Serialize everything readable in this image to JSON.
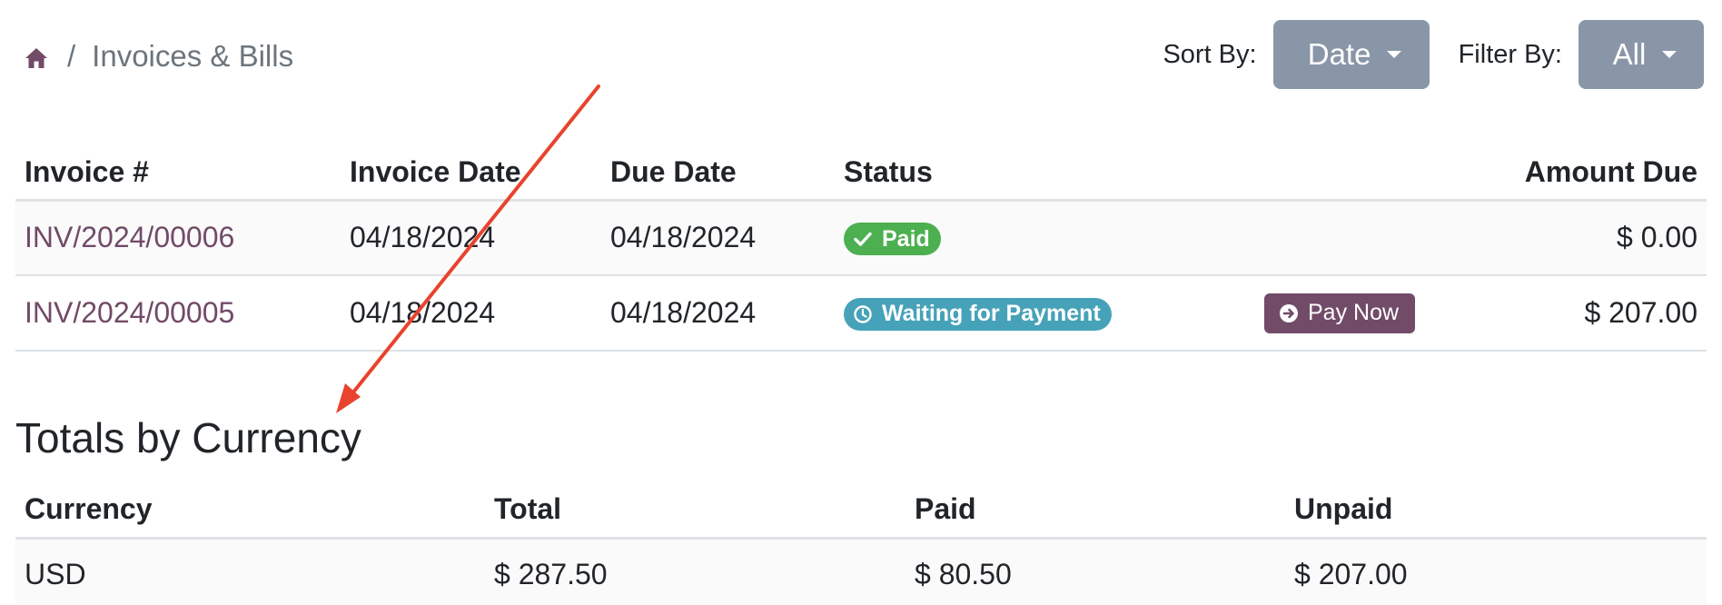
{
  "breadcrumb": {
    "home_icon": "home-icon",
    "separator": "/",
    "current": "Invoices & Bills"
  },
  "controls": {
    "sort_label": "Sort By:",
    "sort_value": "Date",
    "filter_label": "Filter By:",
    "filter_value": "All"
  },
  "invoices": {
    "columns": [
      "Invoice #",
      "Invoice Date",
      "Due Date",
      "Status",
      "",
      "Amount Due"
    ],
    "rows": [
      {
        "number": "INV/2024/00006",
        "invoice_date": "04/18/2024",
        "due_date": "04/18/2024",
        "status": "Paid",
        "status_icon": "check-icon",
        "action": "",
        "amount": "$ 0.00"
      },
      {
        "number": "INV/2024/00005",
        "invoice_date": "04/18/2024",
        "due_date": "04/18/2024",
        "status": "Waiting for Payment",
        "status_icon": "clock-icon",
        "action": "Pay Now",
        "action_icon": "arrow-circle-right-icon",
        "amount": "$ 207.00"
      }
    ]
  },
  "totals": {
    "title": "Totals by Currency",
    "columns": [
      "Currency",
      "Total",
      "Paid",
      "Unpaid"
    ],
    "rows": [
      {
        "currency": "USD",
        "total": "$ 287.50",
        "paid": "$ 80.50",
        "unpaid": "$ 207.00"
      }
    ]
  },
  "colors": {
    "link": "#714b67",
    "paid_badge": "#4caf50",
    "waiting_badge": "#46a2b8",
    "pay_button": "#714b67",
    "dropdown": "#8996a7",
    "annotation_arrow": "#e8432d"
  }
}
